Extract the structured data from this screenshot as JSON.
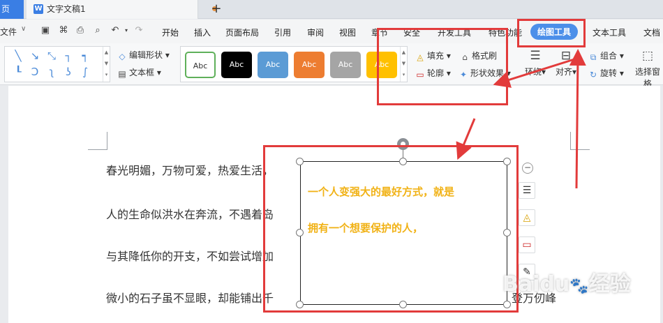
{
  "titlebar": {
    "home_tab": "页",
    "doc_tab_icon": "W",
    "doc_tab_title": "文字文稿1",
    "new_tab": "+"
  },
  "menubar": {
    "file": "文件",
    "items": [
      "开始",
      "插入",
      "页面布局",
      "引用",
      "审阅",
      "视图",
      "章节",
      "安全",
      "开发工具",
      "特色功能",
      "绘图工具",
      "文本工具",
      "文档"
    ],
    "active": "绘图工具"
  },
  "ribbon": {
    "edit_shape": "编辑形状",
    "text_box": "文本框",
    "style_swatches": [
      {
        "label": "Abc",
        "bg": "#ffffff",
        "fg": "#333333",
        "border": "#5fb05a"
      },
      {
        "label": "Abc",
        "bg": "#000000",
        "fg": "#ffffff",
        "border": "#000000"
      },
      {
        "label": "Abc",
        "bg": "#5b9bd5",
        "fg": "#ffffff",
        "border": "#5b9bd5"
      },
      {
        "label": "Abc",
        "bg": "#ed7d31",
        "fg": "#ffffff",
        "border": "#ed7d31"
      },
      {
        "label": "Abc",
        "bg": "#a5a5a5",
        "fg": "#ffffff",
        "border": "#a5a5a5"
      },
      {
        "label": "Abc",
        "bg": "#ffc000",
        "fg": "#ffffff",
        "border": "#ffc000"
      }
    ],
    "fill": "填充",
    "format_painter": "格式刷",
    "outline": "轮廓",
    "shape_effects": "形状效果",
    "wrap": "环绕",
    "align": "对齐",
    "group": "组合",
    "rotate": "旋转",
    "selection_pane": "选择窗格"
  },
  "document": {
    "paragraphs": [
      "春光明媚，万物可爱，热爱生活，",
      "人的生命似洪水在奔流，不遇着岛",
      "与其降低你的开支，不如尝试增加",
      "微小的石子虽不显眼，却能铺出千"
    ],
    "para_tail": "登万仞峰"
  },
  "textbox": {
    "line1": "一个人变强大的最好方式，就是",
    "line2": "拥有一个想要保护的人，"
  },
  "watermark": {
    "brand": "Baidu",
    "suffix": "经验"
  },
  "colors": {
    "accent_blue": "#4c8fe9",
    "annotation_red": "#e23b3b",
    "textbox_text": "#f1b216"
  }
}
